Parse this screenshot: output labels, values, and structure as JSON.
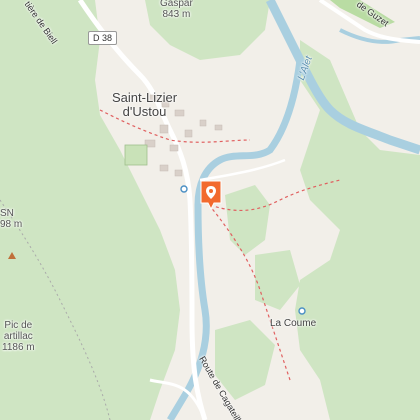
{
  "map": {
    "road_shield": "D 38",
    "places": {
      "town_line1": "Saint-Lizier",
      "town_line2": "d'Ustou",
      "hamlet": "La Coume"
    },
    "peaks": {
      "gaspar_name": "Gaspar",
      "gaspar_elev": "843 m",
      "left_name": "SN",
      "left_elev": "98 m",
      "pic_line1": "Pic de",
      "pic_line2": "artillac",
      "pic_elev": "1186 m"
    },
    "rivers": {
      "alet": "L'Alet"
    },
    "roads": {
      "top_left": "tière de Biell",
      "top_right": "de Guzet",
      "bottom": "Route de Cagateill"
    },
    "marker_icon": "location-pin-icon",
    "colors": {
      "forest": "#cfe5c3",
      "land": "#f2efe9",
      "water": "#a9cfe0",
      "marker": "#f26a2e",
      "trail": "#e06060"
    }
  }
}
